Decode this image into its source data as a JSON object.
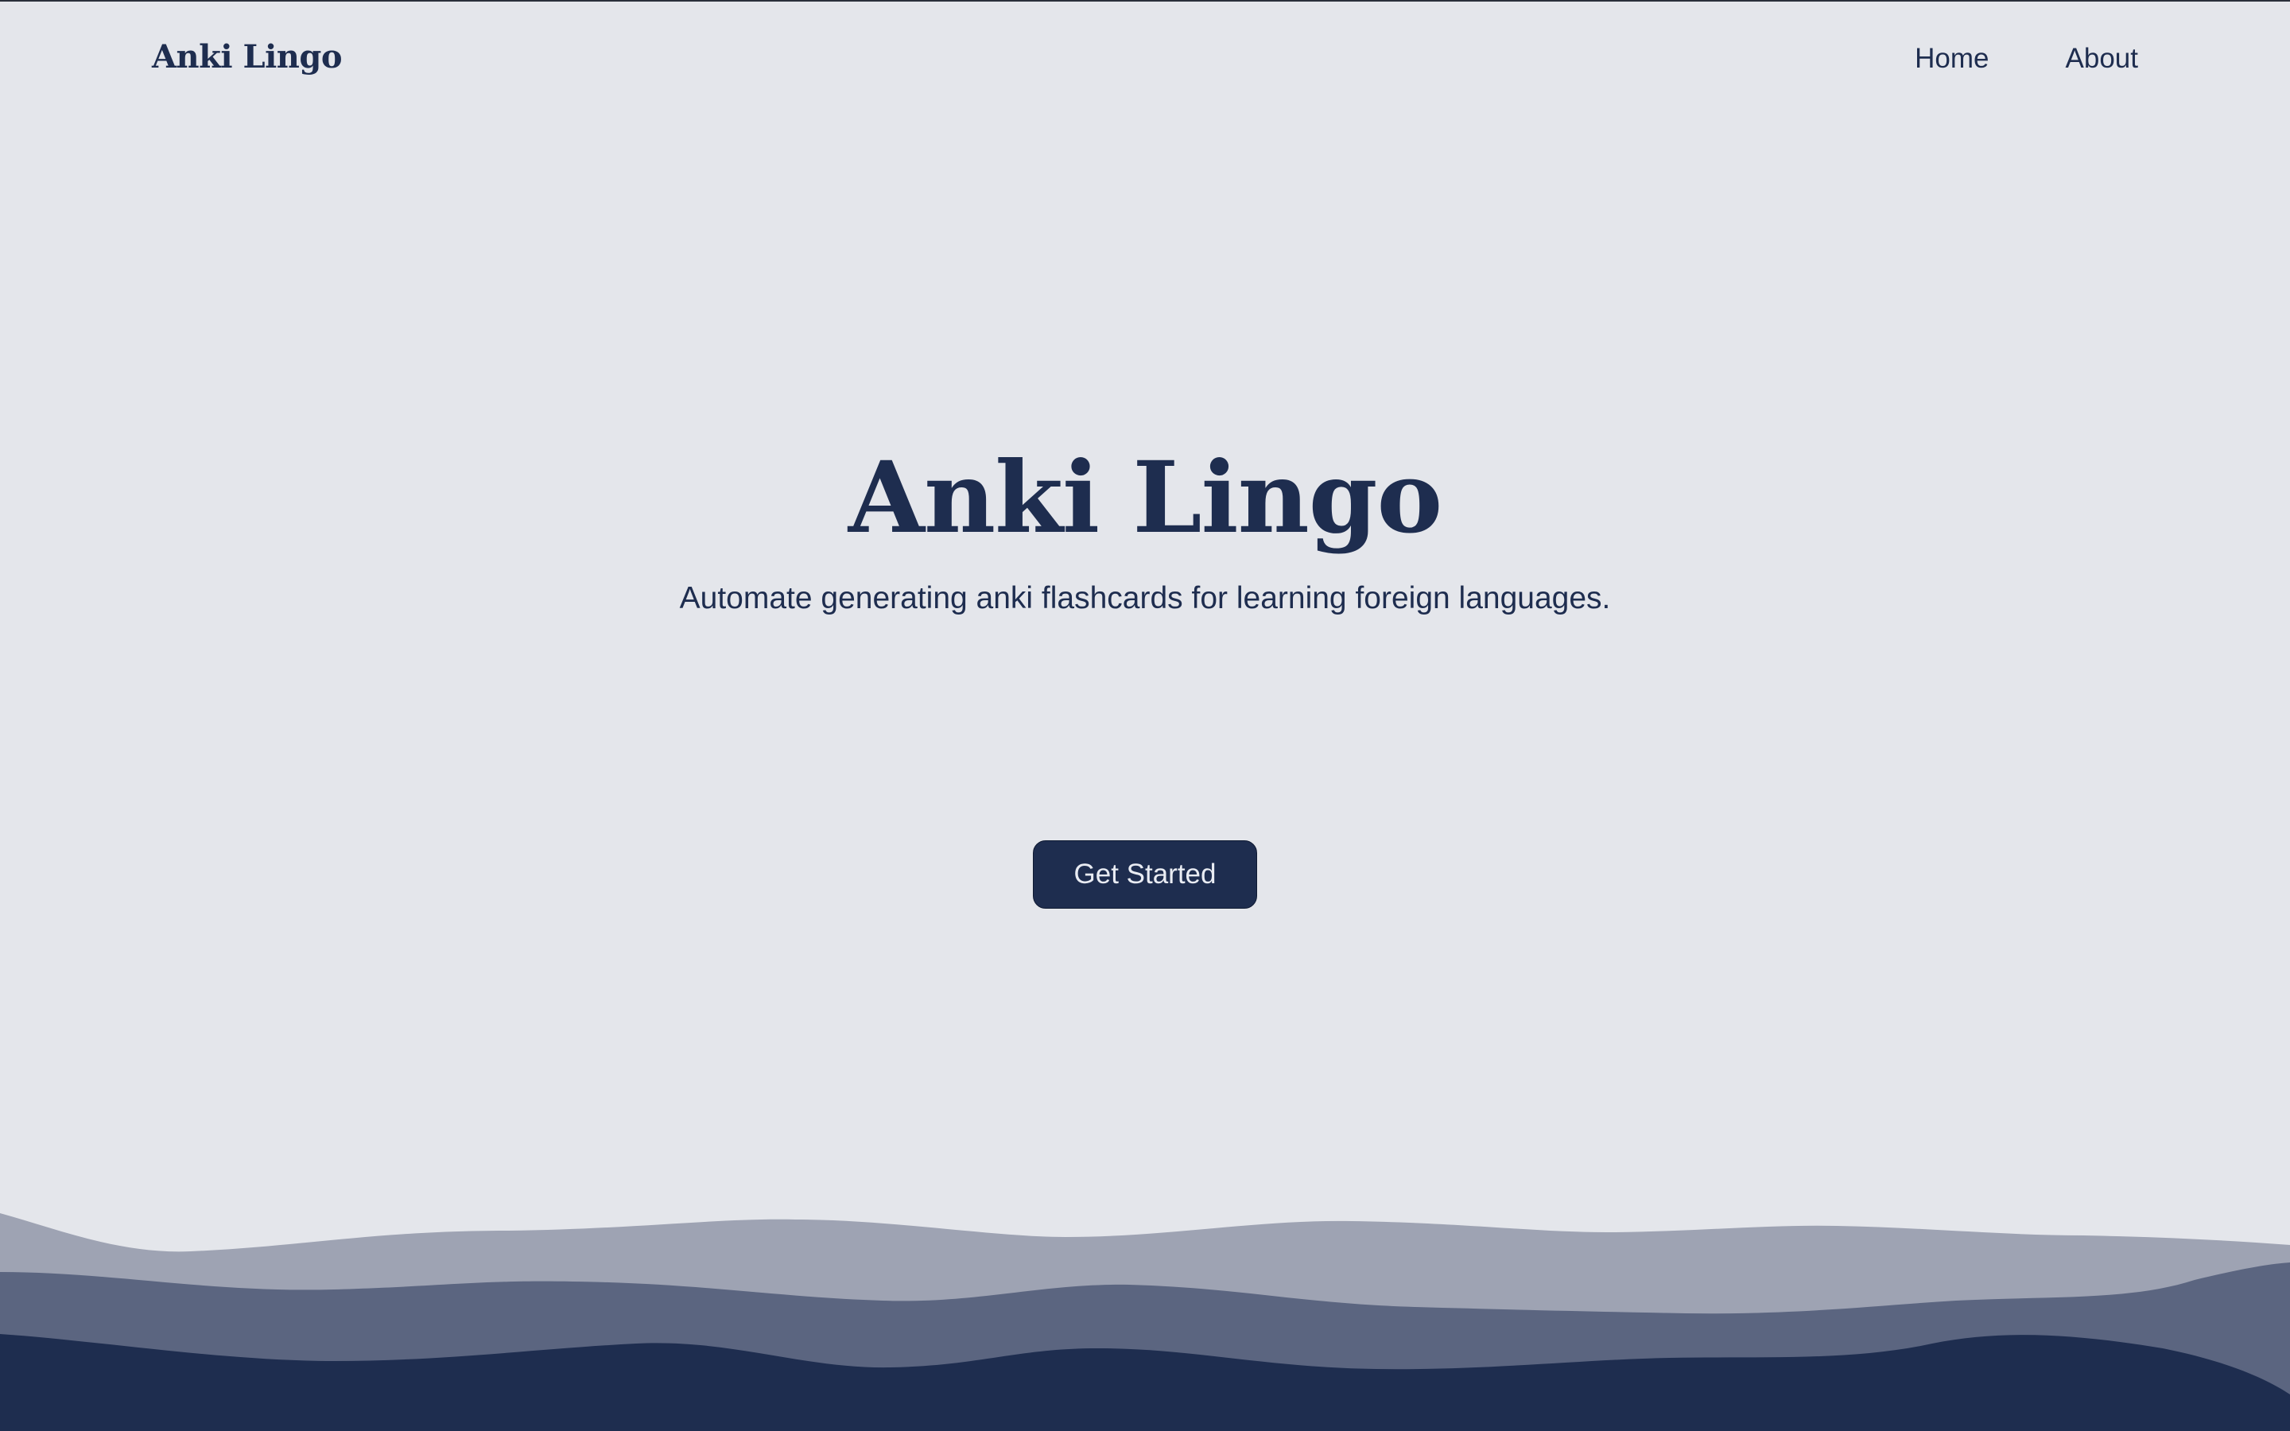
{
  "header": {
    "brand": "Anki Lingo",
    "nav": [
      {
        "label": "Home"
      },
      {
        "label": "About"
      }
    ]
  },
  "hero": {
    "title": "Anki Lingo",
    "subtitle": "Automate generating anki flashcards for learning foreign languages.",
    "cta_label": "Get Started"
  },
  "colors": {
    "background": "#e4e6eb",
    "primary": "#1e2d4f",
    "wave_light": "#9ea3b3",
    "wave_mid": "#5b6580",
    "wave_dark": "#1e2d4f"
  }
}
